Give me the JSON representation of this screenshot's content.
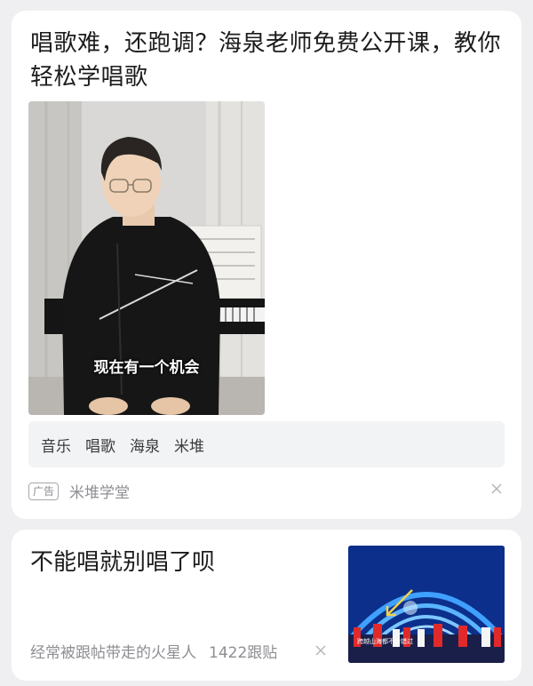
{
  "feed": {
    "ad_card": {
      "title": "唱歌难，还跑调？海泉老师免费公开课，教你轻松学唱歌",
      "video_caption": "现在有一个机会",
      "tags": [
        "音乐",
        "唱歌",
        "海泉",
        "米堆"
      ],
      "ad_label": "广告",
      "source": "米堆学堂",
      "close_icon": "close-icon"
    },
    "post_card": {
      "title": "不能唱就别唱了呗",
      "author": "经常被跟帖带走的火星人",
      "replies": "1422跟贴",
      "close_icon": "close-icon",
      "thumbnail_caption": "跨越山海都不会错过"
    }
  },
  "colors": {
    "background": "#efeff1",
    "card": "#ffffff",
    "tag_bg": "#f2f3f5",
    "meta_text": "#8e8e93",
    "title_text": "#1c1c1e"
  }
}
